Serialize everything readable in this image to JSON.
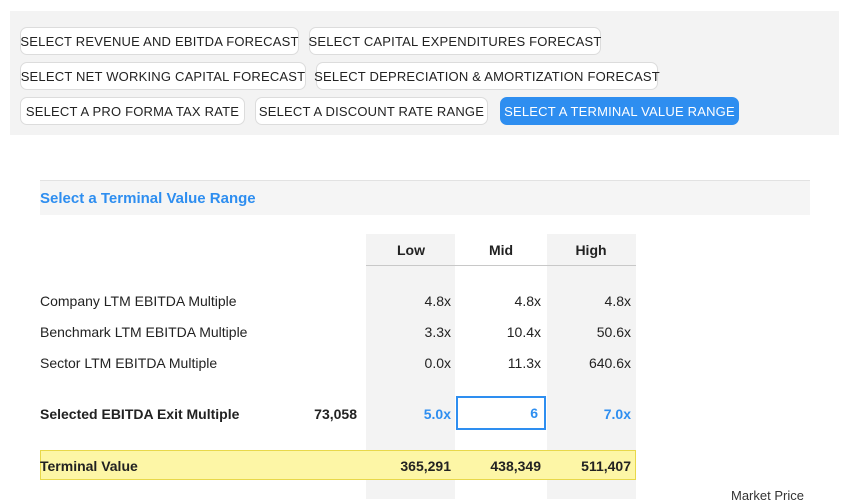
{
  "tabs": [
    {
      "label": "SELECT REVENUE AND EBITDA FORECAST",
      "active": false
    },
    {
      "label": "SELECT CAPITAL EXPENDITURES FORECAST",
      "active": false
    },
    {
      "label": "SELECT NET WORKING CAPITAL FORECAST",
      "active": false
    },
    {
      "label": "SELECT DEPRECIATION & AMORTIZATION FORECAST",
      "active": false
    },
    {
      "label": "SELECT A PRO FORMA TAX RATE",
      "active": false
    },
    {
      "label": "SELECT A DISCOUNT RATE RANGE",
      "active": false
    },
    {
      "label": "SELECT A TERMINAL VALUE RANGE",
      "active": true
    }
  ],
  "section": {
    "title": "Select a Terminal Value Range"
  },
  "columns": {
    "low": "Low",
    "mid": "Mid",
    "high": "High"
  },
  "rows": [
    {
      "label": "Company LTM EBITDA Multiple",
      "low": "4.8x",
      "mid": "4.8x",
      "high": "4.8x"
    },
    {
      "label": "Benchmark LTM EBITDA Multiple",
      "low": "3.3x",
      "mid": "10.4x",
      "high": "50.6x"
    },
    {
      "label": "Sector LTM EBITDA Multiple",
      "low": "0.0x",
      "mid": "11.3x",
      "high": "640.6x"
    }
  ],
  "selected": {
    "label": "Selected EBITDA Exit Multiple",
    "ebitda": "73,058",
    "low": "5.0x",
    "mid_value": "6",
    "high": "7.0x"
  },
  "terminal_value": {
    "label": "Terminal Value",
    "low": "365,291",
    "mid": "438,349",
    "high": "511,407"
  },
  "footer": {
    "market_price": "Market Price"
  },
  "colors": {
    "accent": "#2e8ef0",
    "highlight": "#fdf6a6"
  }
}
